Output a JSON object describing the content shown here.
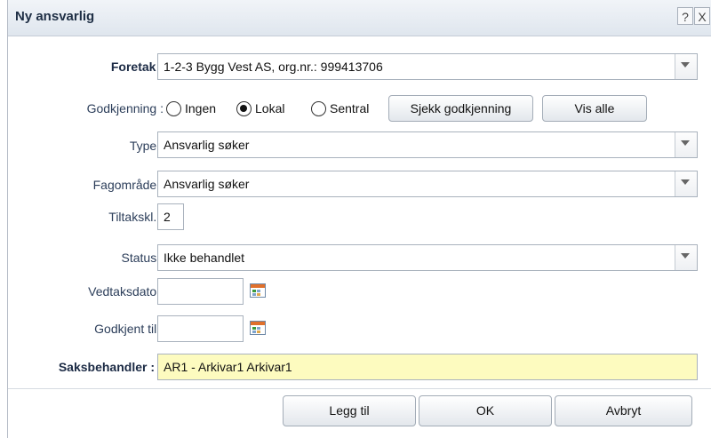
{
  "window": {
    "title": "Ny ansvarlig",
    "help_glyph": "?",
    "close_glyph": "X"
  },
  "form": {
    "foretak": {
      "label": "Foretak :",
      "value": "1-2-3 Bygg Vest AS, org.nr.: 999413706"
    },
    "godkjenning": {
      "label": "Godkjenning :",
      "options": [
        "Ingen",
        "Lokal",
        "Sentral"
      ],
      "selected": "Lokal",
      "check_button": "Sjekk godkjenning",
      "show_all_button": "Vis alle"
    },
    "type": {
      "label": "Type :",
      "value": "Ansvarlig søker"
    },
    "fagomrade": {
      "label": "Fagområde :",
      "value": "Ansvarlig søker"
    },
    "tiltakskl": {
      "label": "Tiltakskl. :",
      "value": "2"
    },
    "status": {
      "label": "Status :",
      "value": "Ikke behandlet"
    },
    "vedtaksdato": {
      "label": "Vedtaksdato :",
      "value": ""
    },
    "godkjent_til": {
      "label": "Godkjent til :",
      "value": ""
    },
    "saksbehandler": {
      "label": "Saksbehandler :",
      "value": "AR1 - Arkivar1 Arkivar1"
    }
  },
  "buttons": {
    "add": "Legg til",
    "ok": "OK",
    "cancel": "Avbryt"
  },
  "colors": {
    "highlight_field": "#fdfbbf",
    "title_text": "#1f2f45",
    "calendar_header": "#e0702c"
  },
  "icons": [
    "help-icon",
    "close-icon",
    "chevron-down-icon",
    "calendar-icon"
  ]
}
